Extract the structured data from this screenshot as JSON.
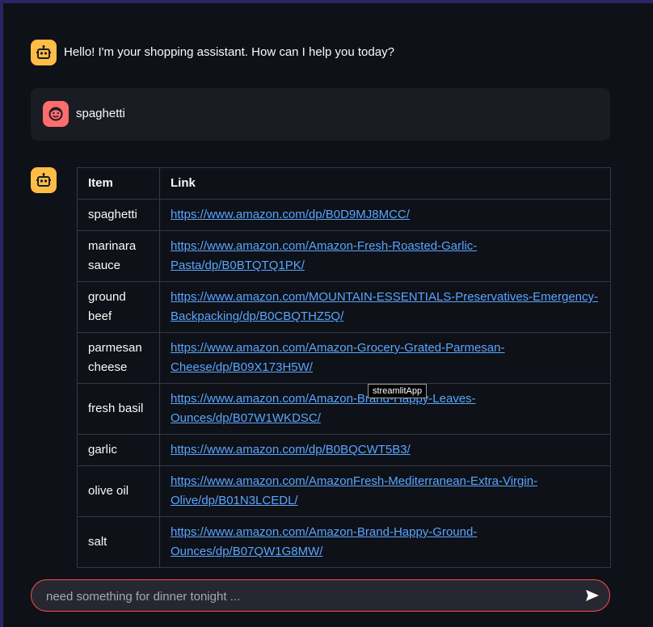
{
  "chat": {
    "assistant_greeting": "Hello! I'm your shopping assistant. How can I help you today?",
    "user_message": "spaghetti"
  },
  "table": {
    "headers": {
      "item": "Item",
      "link": "Link"
    },
    "rows": [
      {
        "item": "spaghetti",
        "link": "https://www.amazon.com/dp/B0D9MJ8MCC/"
      },
      {
        "item": "marinara sauce",
        "link": "https://www.amazon.com/Amazon-Fresh-Roasted-Garlic-Pasta/dp/B0BTQTQ1PK/"
      },
      {
        "item": "ground beef",
        "link": "https://www.amazon.com/MOUNTAIN-ESSENTIALS-Preservatives-Emergency-Backpacking/dp/B0CBQTHZ5Q/"
      },
      {
        "item": "parmesan cheese",
        "link": "https://www.amazon.com/Amazon-Grocery-Grated-Parmesan-Cheese/dp/B09X173H5W/"
      },
      {
        "item": "fresh basil",
        "link": "https://www.amazon.com/Amazon-Brand-Happy-Leaves-Ounces/dp/B07W1WKDSC/"
      },
      {
        "item": "garlic",
        "link": "https://www.amazon.com/dp/B0BQCWT5B3/"
      },
      {
        "item": "olive oil",
        "link": "https://www.amazon.com/AmazonFresh-Mediterranean-Extra-Virgin-Olive/dp/B01N3LCEDL/"
      },
      {
        "item": "salt",
        "link": "https://www.amazon.com/Amazon-Brand-Happy-Ground-Ounces/dp/B07QW1G8MW/"
      }
    ]
  },
  "tooltip": {
    "text": "streamlitApp"
  },
  "chat_input": {
    "placeholder": "need something for dinner tonight ..."
  },
  "icons": {
    "assistant": "robot-icon",
    "user": "face-icon",
    "send": "send-icon"
  },
  "colors": {
    "background": "#0e1117",
    "outer_background": "#2b2465",
    "assistant_avatar": "#ffbd45",
    "user_avatar": "#ff6c6c",
    "link": "#5aa5ff",
    "input_border": "#ff4b4b"
  }
}
